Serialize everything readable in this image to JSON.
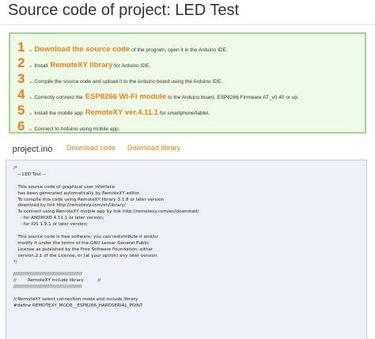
{
  "page": {
    "title": "Source code of project: LED Test"
  },
  "steps": [
    {
      "num": "1",
      "highlight": "Download the source code",
      "text": "of the program, open it in the Arduino IDE."
    },
    {
      "num": "2",
      "pre": "Install",
      "highlight": "RemoteXY library",
      "text": "for Arduino IDE."
    },
    {
      "num": "3",
      "text": "Compile the source code and upload it to the Arduino board using the Arduino IDE."
    },
    {
      "num": "4",
      "pre": "Correctly connect the",
      "highlight": "ESP8266 Wi-Fi module",
      "text": "to the Arduino board. ESP8266 Firmware AT_v0.40 or up."
    },
    {
      "num": "5",
      "pre": "Install the mobile app",
      "highlight": "RemoteXY ver.4.11.1",
      "text": "for smartphone/tablet."
    },
    {
      "num": "6",
      "text": "Connect to Arduino using mobile app."
    }
  ],
  "tabs": {
    "file": "project.ino",
    "download_code": "Download code",
    "download_library": "Download library"
  },
  "code": {
    "lines": [
      "/*",
      "   -- LED Test --",
      "",
      "   This source code of graphical user interface",
      "   has been generated automatically by RemoteXY editor.",
      "   To compile this code using RemoteXY library 3.1.8 or later version",
      "   download by link http://remotexy.com/en/library/",
      "   To connect using RemoteXY mobile app by link http://remotexy.com/en/download/",
      "     - for ANDROID 4.11.1 or later version;",
      "     - for iOS 1.9.1 or later version;",
      "",
      "   This source code is free software; you can redistribute it and/or",
      "   modify it under the terms of the GNU Lesser General Public",
      "   License as published by the Free Software Foundation; either",
      "   version 2.1 of the License, or (at your option) any later version.",
      "*/",
      "",
      "//////////////////////////////////////////////",
      "//        RemoteXY include library          //",
      "//////////////////////////////////////////////",
      "",
      "// RemoteXY select connection mode and include library",
      "#define REMOTEXY_MODE__ESP8266_HARDSERIAL_POINT"
    ]
  },
  "colors": {
    "accent": "#f07d16",
    "steps_bg": "#effbe9",
    "steps_border": "#9fd58c",
    "code_bg": "#eef0f8"
  }
}
